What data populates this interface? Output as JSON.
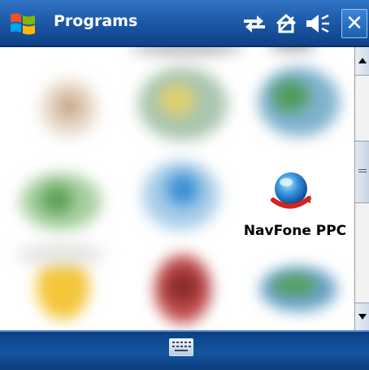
{
  "titlebar": {
    "title": "Programs",
    "icons": [
      "windows-start-icon",
      "connectivity-icon",
      "sync-icon",
      "volume-icon",
      "close-icon"
    ],
    "close_glyph": "✕"
  },
  "programs": [
    {
      "label": "NavFone PPC",
      "icon": "navfone-globe-icon"
    }
  ],
  "softkeys": {
    "center_icon": "keyboard-icon"
  },
  "colors": {
    "title_bar": "#1d5aa8",
    "softkey_bar": "#14559f",
    "content_bg": "#ffffff"
  }
}
